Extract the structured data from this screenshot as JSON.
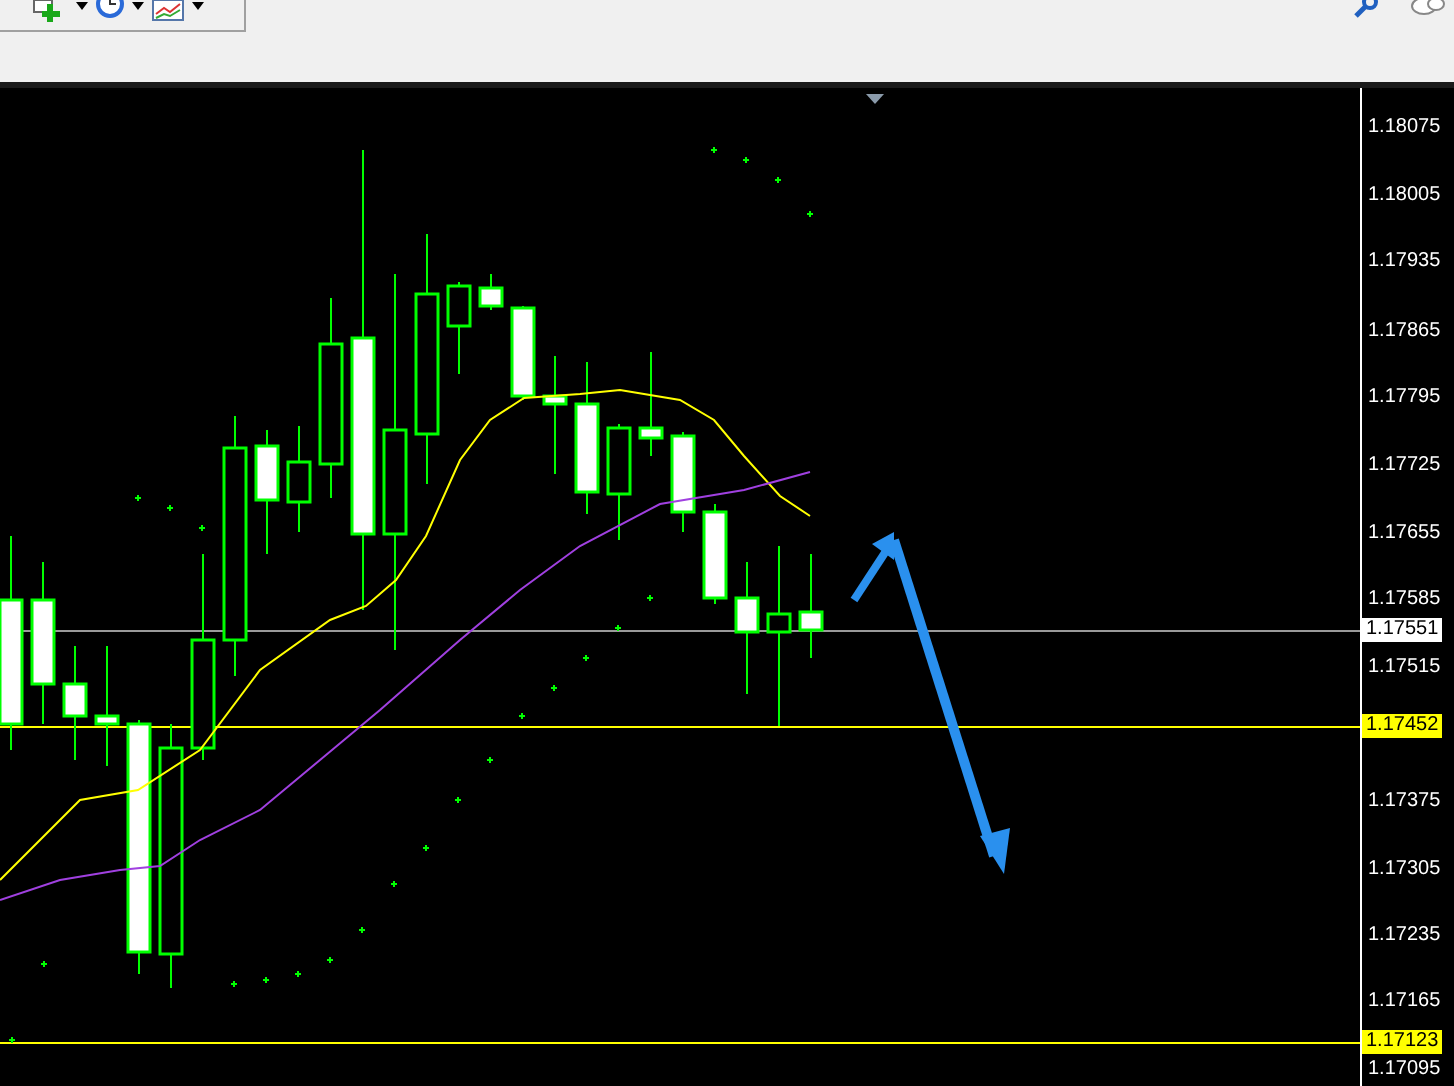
{
  "price_axis": {
    "labels": [
      "1.18075",
      "1.18005",
      "1.17935",
      "1.17865",
      "1.17795",
      "1.17725",
      "1.17655",
      "1.17585",
      "1.17515",
      "1.17375",
      "1.17305",
      "1.17235",
      "1.17165",
      "1.17095"
    ],
    "markers": [
      {
        "text": "1.17551",
        "kind": "bid"
      },
      {
        "text": "1.17452",
        "kind": "level"
      },
      {
        "text": "1.17123",
        "kind": "level"
      }
    ]
  }
}
